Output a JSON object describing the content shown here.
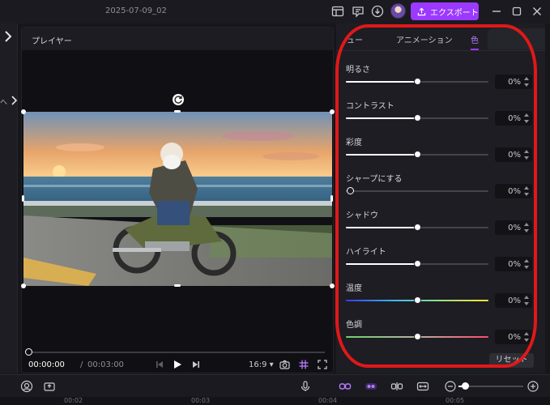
{
  "titlebar": {
    "doc_title": "2025-07-09_02",
    "export_label": "エクスポート"
  },
  "left_strip": {
    "label": "へ"
  },
  "player": {
    "title": "プレイヤー",
    "time_current": "00:00:00",
    "time_separator": "/",
    "time_total": "00:03:00",
    "aspect_ratio": "16:9",
    "aspect_dropdown_glyph": "▾",
    "progress": 0
  },
  "right_panel": {
    "tabs": [
      {
        "label": "ュー"
      },
      {
        "label": "アニメーション"
      },
      {
        "label": "色"
      }
    ],
    "adjustments": [
      {
        "label": "明るさ",
        "value": "0%"
      },
      {
        "label": "コントラスト",
        "value": "0%"
      },
      {
        "label": "彩度",
        "value": "0%"
      },
      {
        "label": "シャープにする",
        "value": "0%"
      },
      {
        "label": "シャドウ",
        "value": "0%"
      },
      {
        "label": "ハイライト",
        "value": "0%"
      },
      {
        "label": "温度",
        "value": "0%"
      },
      {
        "label": "色調",
        "value": "0%"
      }
    ],
    "reset_label": "リセット"
  },
  "ruler": {
    "labels": [
      "00:02",
      "00:03",
      "00:04",
      "00:05"
    ]
  },
  "colors": {
    "accent": "#9b39ff",
    "annotation": "#e01818",
    "panel_bg": "#1d1d23"
  },
  "icons": {
    "titlebar": [
      "layout-icon",
      "feedback-icon",
      "download-icon",
      "avatar",
      "export-icon",
      "minimize-icon",
      "maximize-icon",
      "close-icon"
    ],
    "player": [
      "rotate-icon",
      "prev-frame-icon",
      "play-icon",
      "next-frame-icon",
      "snapshot-icon",
      "grid-icon",
      "fullscreen-icon"
    ],
    "bottom": [
      "face-icon",
      "export-clip-icon",
      "mic-icon",
      "link-icon",
      "mask-icon",
      "split-icon",
      "fit-icon",
      "zoom-out-icon",
      "zoom-in-icon"
    ]
  }
}
